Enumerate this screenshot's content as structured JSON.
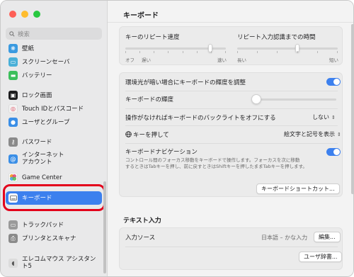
{
  "window": {
    "title": "キーボード"
  },
  "sidebar": {
    "search_placeholder": "検索",
    "items": [
      {
        "label": "壁紙",
        "icon": "wallpaper-icon",
        "color": "#3a9ae0"
      },
      {
        "label": "スクリーンセーバ",
        "icon": "screensaver-icon",
        "color": "#4ab0d8"
      },
      {
        "label": "バッテリー",
        "icon": "battery-icon",
        "color": "#3cbf5b"
      },
      {
        "label": "ロック画面",
        "icon": "lock-icon",
        "color": "#1d1d1f"
      },
      {
        "label": "Touch IDとパスコード",
        "icon": "fingerprint-icon",
        "color": "#f2f2f2"
      },
      {
        "label": "ユーザとグループ",
        "icon": "users-icon",
        "color": "#3a8ee6"
      },
      {
        "label": "パスワード",
        "icon": "key-icon",
        "color": "#8a8a8a"
      },
      {
        "label": "インターネット\nアカウント",
        "icon": "at-icon",
        "color": "#3a8ee6"
      },
      {
        "label": "Game Center",
        "icon": "game-center-icon",
        "color": "#ffffff"
      },
      {
        "label": "キーボード",
        "icon": "keyboard-icon",
        "color": "#9a9a9a",
        "selected": true
      },
      {
        "label": "トラックパッド",
        "icon": "trackpad-icon",
        "color": "#9a9a9a"
      },
      {
        "label": "プリンタとスキャナ",
        "icon": "printer-icon",
        "color": "#8a8a8a"
      },
      {
        "label": "エレコムマウス アシスタント5",
        "icon": "mouse-app-icon",
        "color": "#dcdcdc"
      }
    ]
  },
  "main": {
    "title": "キーボード",
    "repeat": {
      "label": "キーのリピート速度",
      "left": "オフ",
      "slow": "遅い",
      "fast": "速い"
    },
    "delay": {
      "label": "リピート入力認識までの時間",
      "long": "長い",
      "short": "短い"
    },
    "rows": {
      "ambient": "環境光が暗い場合にキーボードの輝度を調整",
      "brightness": "キーボードの輝度",
      "backlight_off": "操作がなければキーボードのバックライトをオフにする",
      "backlight_value": "しない",
      "globe_key": "キーを押して",
      "globe_value": "絵文字と記号を表示",
      "nav": "キーボードナビゲーション",
      "nav_desc_1": "コントロール間のフォーカス移動をキーボードで操作します。フォーカスを次に移動",
      "nav_desc_2": "するときはTabキーを押し、前に戻すときはShiftキーを押したままTabキーを押します。",
      "shortcuts_button": "キーボードショートカット..."
    },
    "text_input": {
      "section": "テキスト入力",
      "input_sources": "入力ソース",
      "input_value": "日本語 – かな入力",
      "edit_button": "編集...",
      "dict_button": "ユーザ辞書..."
    }
  }
}
